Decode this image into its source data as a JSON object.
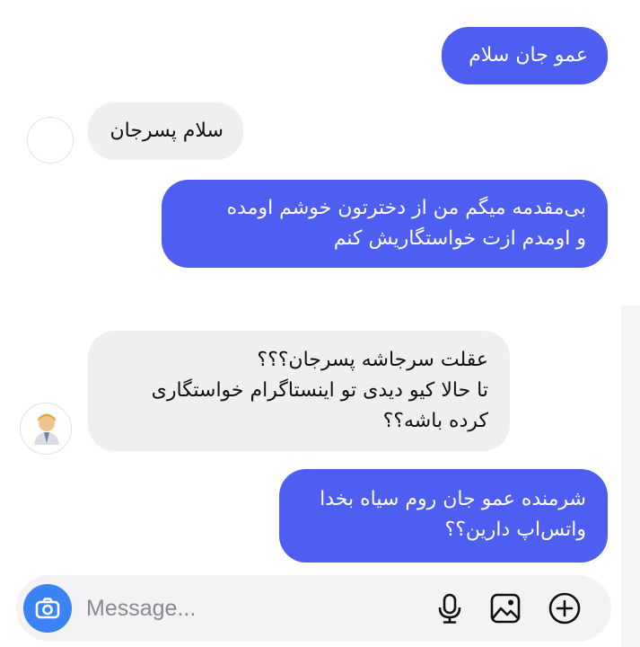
{
  "messages": [
    {
      "direction": "sent",
      "text": "عمو جان سلام"
    },
    {
      "direction": "received",
      "text": "سلام پسرجان"
    },
    {
      "direction": "sent",
      "text": "بی‌مقدمه میگم من از دخترتون خوشم اومده\nو اومدم ازت خواستگاریش کنم"
    },
    {
      "direction": "received",
      "text": "عقلت سرجاشه پسرجان؟؟؟\nتا حالا کیو دیدی تو اینستاگرام خواستگاری\nکرده باشه؟؟"
    },
    {
      "direction": "sent",
      "text": "شرمنده عمو جان روم سیاه بخدا\nواتس‌اپ دارین؟؟"
    }
  ],
  "composer": {
    "placeholder": "Message...",
    "icons": [
      "camera-icon",
      "microphone-icon",
      "gallery-icon",
      "add-icon"
    ]
  },
  "colors": {
    "sent_bubble": "#4d5ef0",
    "received_bubble": "#efeff0",
    "camera_button": "#3b82f2"
  }
}
